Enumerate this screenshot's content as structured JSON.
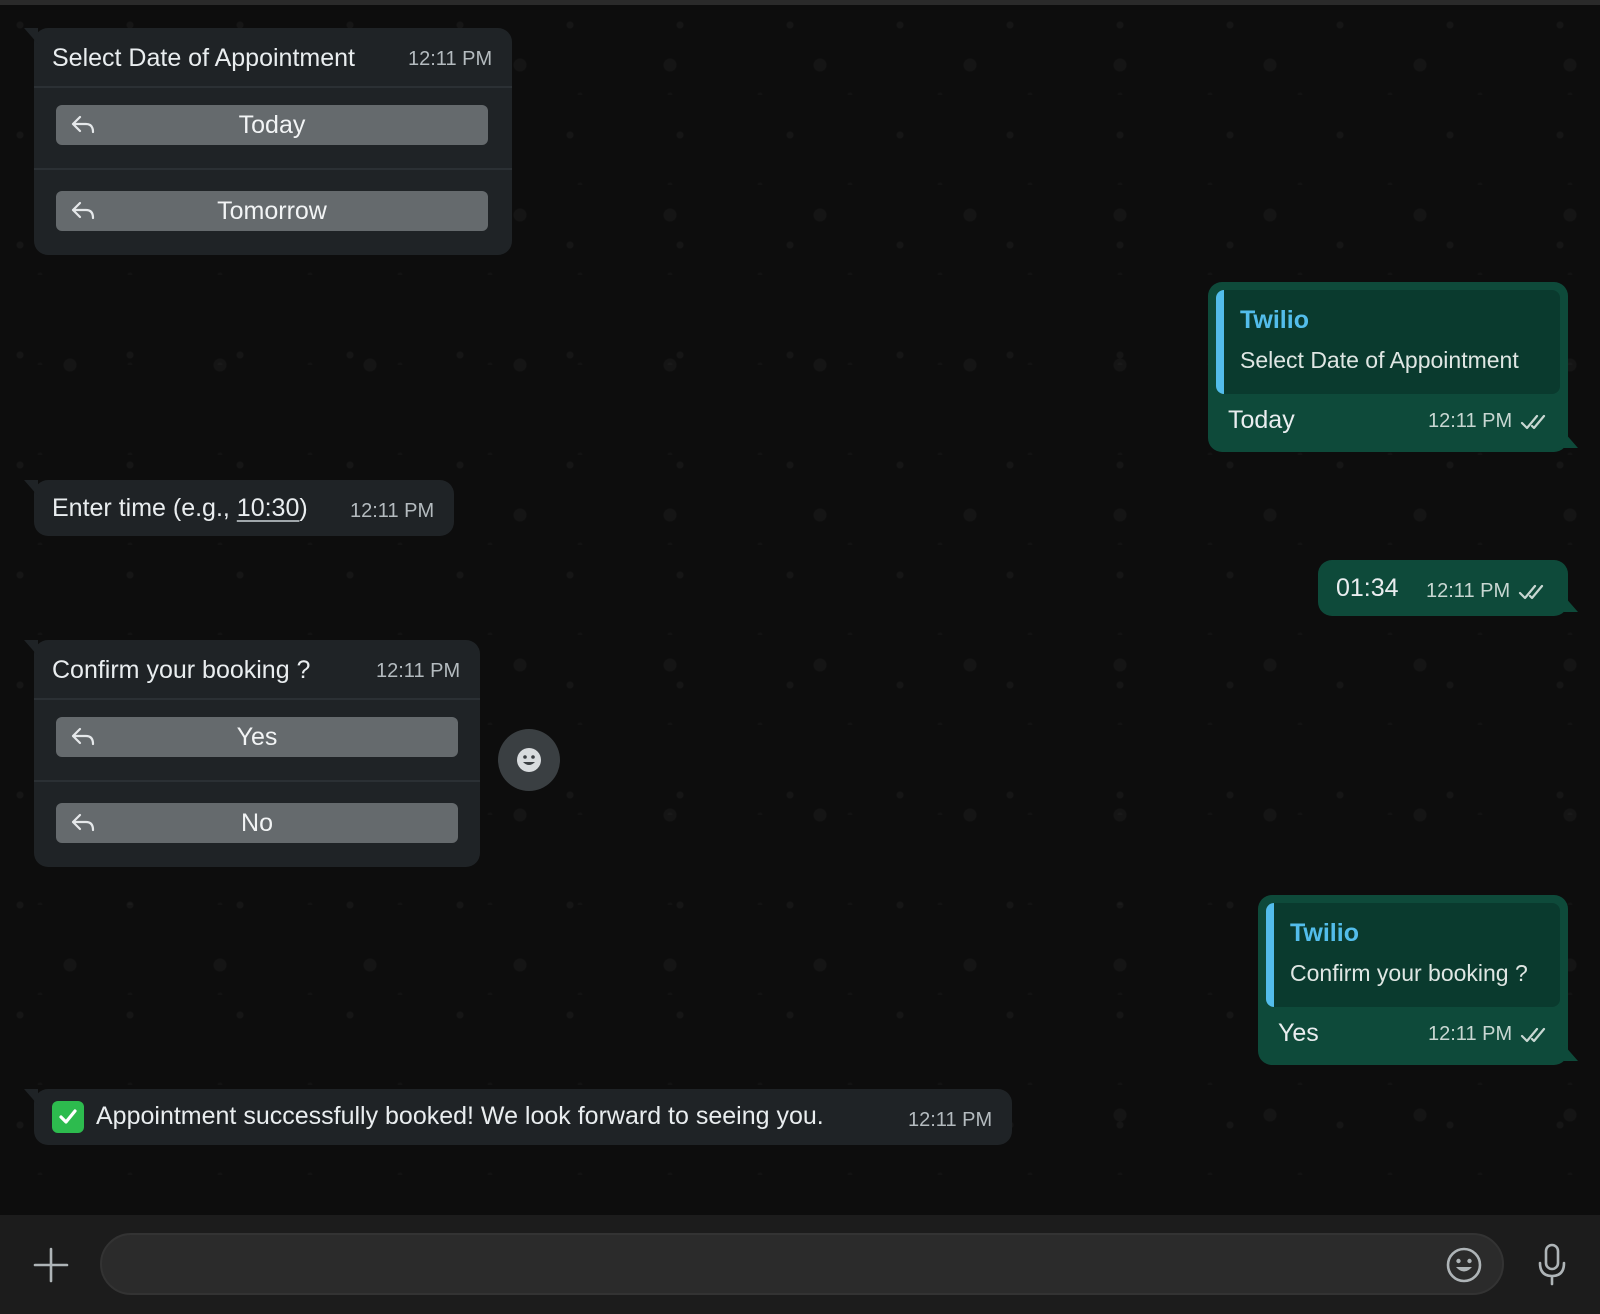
{
  "messages": {
    "date_prompt": {
      "text": "Select Date of Appointment",
      "time": "12:11 PM",
      "buttons": [
        "Today",
        "Tomorrow"
      ]
    },
    "date_reply": {
      "quote_author": "Twilio",
      "quote_text": "Select Date of Appointment",
      "text": "Today",
      "time": "12:11 PM"
    },
    "time_prompt": {
      "text_before": "Enter time (e.g., ",
      "text_link": "10:30",
      "text_after": ")",
      "time": "12:11 PM"
    },
    "time_reply": {
      "text": "01:34",
      "time": "12:11 PM"
    },
    "confirm_prompt": {
      "text": "Confirm your booking ?",
      "time": "12:11 PM",
      "buttons": [
        "Yes",
        "No"
      ]
    },
    "confirm_reply": {
      "quote_author": "Twilio",
      "quote_text": "Confirm your booking ?",
      "text": "Yes",
      "time": "12:11 PM"
    },
    "success": {
      "text": "Appointment successfully booked! We look forward to seeing you.",
      "time": "12:11 PM"
    }
  },
  "icons": {
    "reply": "reply-arrow-icon",
    "read": "double-check-icon",
    "react": "emoji-react-icon",
    "attach": "plus-icon",
    "emoji": "emoji-icon",
    "mic": "microphone-icon",
    "success_emoji": "check-mark-button-emoji"
  },
  "colors": {
    "incoming_bubble": "#1f2326",
    "outgoing_bubble": "#0e4a3a",
    "quote_accent": "#53bdeb",
    "success_check": "#2dbb4e"
  }
}
